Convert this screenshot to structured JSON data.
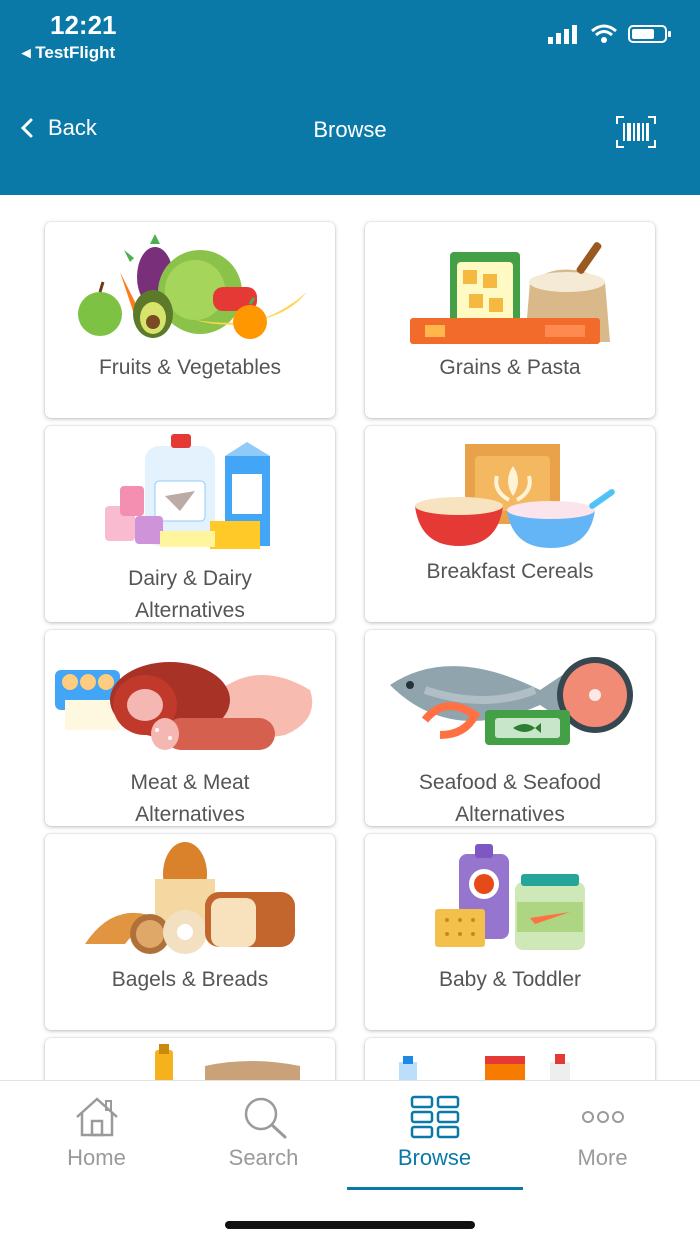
{
  "status_bar": {
    "time": "12:21",
    "back_app": "◂ TestFlight"
  },
  "nav": {
    "back_label": "Back",
    "title": "Browse"
  },
  "categories": [
    {
      "line1": "Fruits & Vegetables",
      "line2": ""
    },
    {
      "line1": "Grains & Pasta",
      "line2": ""
    },
    {
      "line1": "Dairy & Dairy",
      "line2": "Alternatives"
    },
    {
      "line1": "Breakfast Cereals",
      "line2": ""
    },
    {
      "line1": "Meat & Meat",
      "line2": "Alternatives"
    },
    {
      "line1": "Seafood & Seafood",
      "line2": "Alternatives"
    },
    {
      "line1": "Bagels & Breads",
      "line2": ""
    },
    {
      "line1": "Baby & Toddler",
      "line2": ""
    }
  ],
  "tabs": [
    {
      "label": "Home",
      "icon": "home-icon"
    },
    {
      "label": "Search",
      "icon": "search-icon"
    },
    {
      "label": "Browse",
      "icon": "grid-icon",
      "active": true
    },
    {
      "label": "More",
      "icon": "more-icon"
    }
  ],
  "colors": {
    "brand": "#0b79a8",
    "inactive": "#9a9a9a",
    "label": "#555555"
  }
}
